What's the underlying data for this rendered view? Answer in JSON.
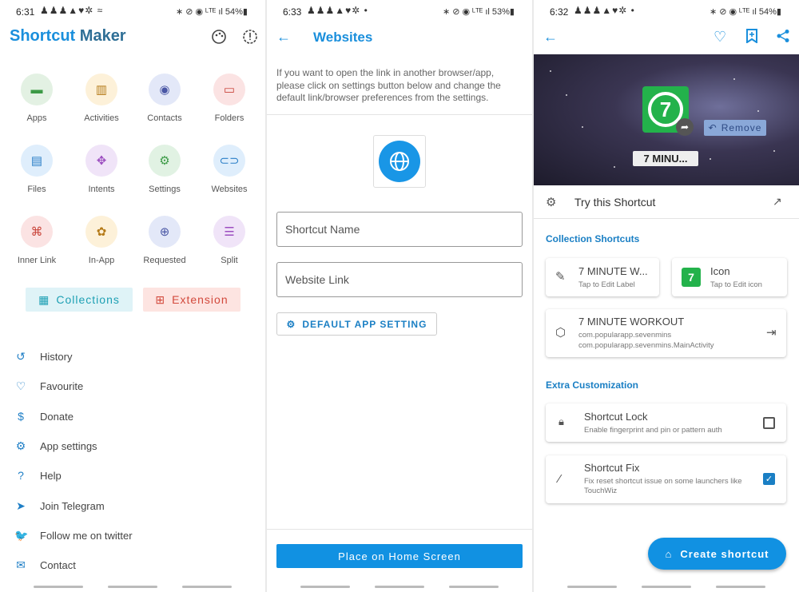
{
  "panel1": {
    "status": {
      "time": "6:31",
      "notif_icons": "♟♟♟▲♥✲ ≈",
      "sys_icons": "∗ ⊘ ◉ ᴸᵀᴱ ıl 54%▮"
    },
    "app_title_part1": "Shortcut",
    "app_title_part2": "Maker",
    "grid": [
      {
        "label": "Apps",
        "icon": "android-icon",
        "glyph": "▬",
        "bg": "#e3f1e3",
        "fg": "#3c9a46"
      },
      {
        "label": "Activities",
        "icon": "activities-icon",
        "glyph": "▥",
        "bg": "#fdf1d9",
        "fg": "#b57b19"
      },
      {
        "label": "Contacts",
        "icon": "contacts-icon",
        "glyph": "◉",
        "bg": "#e3e8f8",
        "fg": "#4a57a5"
      },
      {
        "label": "Folders",
        "icon": "folder-icon",
        "glyph": "▭",
        "bg": "#fbe3e3",
        "fg": "#c9443a"
      },
      {
        "label": "Files",
        "icon": "file-icon",
        "glyph": "▤",
        "bg": "#dfeefc",
        "fg": "#2b7fc7"
      },
      {
        "label": "Intents",
        "icon": "intents-icon",
        "glyph": "✥",
        "bg": "#f0e4f8",
        "fg": "#9c4ec0"
      },
      {
        "label": "Settings",
        "icon": "settings-icon",
        "glyph": "⚙",
        "bg": "#e1f2e3",
        "fg": "#3c9a46"
      },
      {
        "label": "Websites",
        "icon": "link-icon",
        "glyph": "⊂⊃",
        "bg": "#dfeefc",
        "fg": "#2b7fc7"
      },
      {
        "label": "Inner Link",
        "icon": "command-icon",
        "glyph": "⌘",
        "bg": "#fbe3e3",
        "fg": "#c9443a"
      },
      {
        "label": "In-App",
        "icon": "puzzle-icon",
        "glyph": "✿",
        "bg": "#fdf1d9",
        "fg": "#b57b19"
      },
      {
        "label": "Requested",
        "icon": "add-person-icon",
        "glyph": "⊕",
        "bg": "#e3e8f8",
        "fg": "#4a57a5"
      },
      {
        "label": "Split",
        "icon": "split-icon",
        "glyph": "☰",
        "bg": "#f0e4f8",
        "fg": "#9c4ec0"
      }
    ],
    "collections_label": "Collections",
    "extension_label": "Extension",
    "menu": [
      {
        "label": "History",
        "icon": "history-icon",
        "glyph": "↺"
      },
      {
        "label": "Favourite",
        "icon": "heart-icon",
        "glyph": "♡"
      },
      {
        "label": "Donate",
        "icon": "dollar-icon",
        "glyph": "$"
      },
      {
        "label": "App settings",
        "icon": "gear-icon",
        "glyph": "⚙"
      },
      {
        "label": "Help",
        "icon": "help-icon",
        "glyph": "?"
      },
      {
        "label": "Join Telegram",
        "icon": "telegram-icon",
        "glyph": "➤"
      },
      {
        "label": "Follow me on twitter",
        "icon": "twitter-icon",
        "glyph": "🐦"
      },
      {
        "label": "Contact",
        "icon": "mail-icon",
        "glyph": "✉"
      }
    ]
  },
  "panel2": {
    "status": {
      "time": "6:33",
      "notif_icons": "♟♟♟▲♥✲ •",
      "sys_icons": "∗ ⊘ ◉ ᴸᵀᴱ ıl 53%▮"
    },
    "title": "Websites",
    "info": "If you want to open the link in another browser/app, please click on settings button below and change the default link/browser preferences from the settings.",
    "shortcut_name_placeholder": "Shortcut Name",
    "website_link_placeholder": "Website Link",
    "default_app_setting": "DEFAULT APP SETTING",
    "place_home": "Place on Home Screen"
  },
  "panel3": {
    "status": {
      "time": "6:32",
      "notif_icons": "♟♟♟▲♥✲ •",
      "sys_icons": "∗ ⊘ ◉ ᴸᵀᴱ ıl 54%▮"
    },
    "remove": "Remove",
    "hero_label": "7 MINU...",
    "try_label": "Try this Shortcut",
    "collection_header": "Collection Shortcuts",
    "label_card_title": "7 MINUTE W...",
    "label_card_sub": "Tap to Edit Label",
    "icon_card_title": "Icon",
    "icon_card_sub": "Tap to Edit icon",
    "activity_title": "7 MINUTE WORKOUT",
    "activity_pkg": "com.popularapp.sevenmins",
    "activity_class": "com.popularapp.sevenmins.MainActivity",
    "extra_header": "Extra Customization",
    "lock_title": "Shortcut Lock",
    "lock_sub": "Enable fingerprint and pin or pattern auth",
    "lock_checked": false,
    "fix_title": "Shortcut Fix",
    "fix_sub": "Fix reset shortcut issue on some launchers like TouchWiz",
    "fix_checked": true,
    "create_label": "Create shortcut"
  }
}
